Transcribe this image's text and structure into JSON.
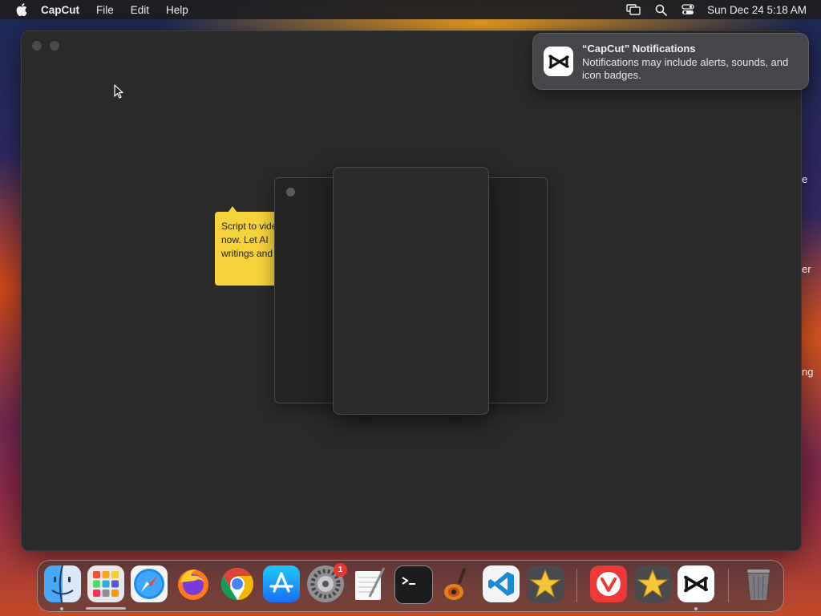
{
  "menubar": {
    "app_name": "CapCut",
    "items": [
      "File",
      "Edit",
      "Help"
    ],
    "clock": "Sun Dec 24  5:18 AM",
    "icons": [
      "apple-icon",
      "screen-mirroring-icon",
      "search-icon",
      "control-center-icon"
    ]
  },
  "tooltip": {
    "line1": "Script to video",
    "line2": "now. Let AI",
    "line3": "writings and"
  },
  "edge_fragments": [
    "e",
    "er",
    "ng"
  ],
  "notification": {
    "title": "“CapCut” Notifications",
    "body": "Notifications may include alerts, sounds, and icon badges."
  },
  "dock": {
    "items": [
      {
        "name": "finder",
        "icon": "finder-icon"
      },
      {
        "name": "launchpad",
        "icon": "launchpad-icon"
      },
      {
        "name": "safari",
        "icon": "safari-icon"
      },
      {
        "name": "firefox",
        "icon": "firefox-icon"
      },
      {
        "name": "chrome",
        "icon": "chrome-icon"
      },
      {
        "name": "app-store",
        "icon": "app-store-icon"
      },
      {
        "name": "system-settings",
        "icon": "settings-icon",
        "badge": "1"
      },
      {
        "name": "textedit",
        "icon": "textedit-icon"
      },
      {
        "name": "terminal",
        "icon": "terminal-icon"
      },
      {
        "name": "garageband",
        "icon": "guitar-icon"
      },
      {
        "name": "vscode",
        "icon": "vscode-icon"
      },
      {
        "name": "reeder",
        "icon": "star-icon"
      },
      {
        "name": "vivaldi",
        "icon": "vivaldi-icon"
      },
      {
        "name": "reeder-2",
        "icon": "star-icon"
      },
      {
        "name": "capcut",
        "icon": "capcut-icon"
      },
      {
        "name": "trash",
        "icon": "trash-icon"
      }
    ]
  },
  "colors": {
    "window_bg": "#2a2a2b",
    "tooltip_bg": "#f4d23c",
    "badge": "#e8372c"
  }
}
